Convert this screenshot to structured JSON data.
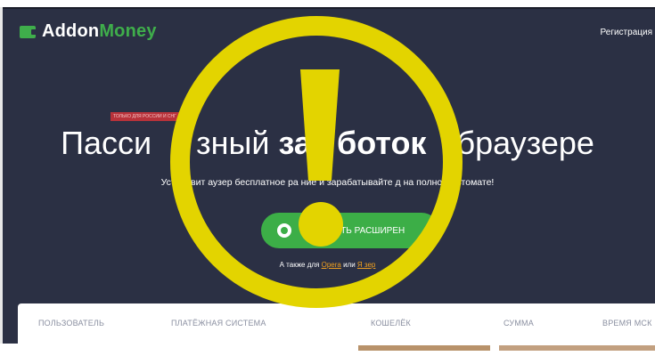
{
  "header": {
    "logo_part1": "Addon",
    "logo_part2": "Money",
    "register_link": "Регистрация"
  },
  "hero": {
    "badge": "ТОЛЬКО ДЛЯ РОССИИ И СНГ",
    "headline_part1": "Пасси",
    "headline_part2": "зный ",
    "headline_bold1": "за",
    "headline_bold2": "боток",
    "headline_part3": "браузере",
    "subline": "Установит  аузер бесплатное ра   ние и зарабатывайте д    на полном автомате!",
    "cta_label": "ИТЬ РАСШИРЕН",
    "also_prefix": "А также для ",
    "also_link1": "Opera",
    "also_mid": " или ",
    "also_link2": "Я         зер"
  },
  "table": {
    "columns": [
      "ПОЛЬЗОВАТЕЛЬ",
      "ПЛАТЁЖНАЯ СИСТЕМА",
      "КОШЕЛЁК",
      "СУММА",
      "ВРЕМЯ МСК"
    ]
  },
  "colors": {
    "hero_bg": "#2b3044",
    "brand_green": "#3fae4b",
    "warning_yellow": "#e3d400",
    "link_orange": "#f0a020"
  },
  "icons": {
    "logo": "wallet-icon",
    "cta": "chrome-icon",
    "overlay": "exclamation-warning-icon"
  }
}
